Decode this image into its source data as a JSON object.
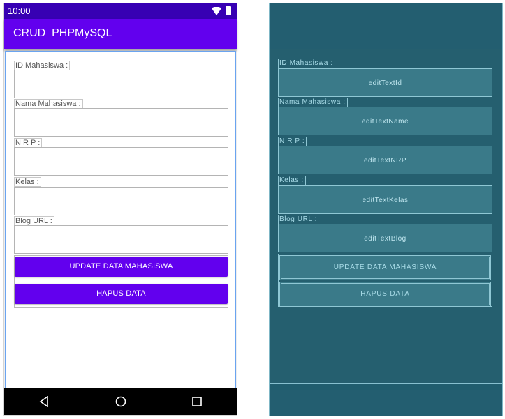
{
  "status_bar": {
    "time": "10:00"
  },
  "app_bar": {
    "title": "CRUD_PHPMySQL"
  },
  "form": {
    "fields": [
      {
        "label": "ID Mahasiswa :",
        "id": "editTextId"
      },
      {
        "label": "Nama Mahasiswa :",
        "id": "editTextName"
      },
      {
        "label": "N R P :",
        "id": "editTextNRP"
      },
      {
        "label": "Kelas :",
        "id": "editTextKelas"
      },
      {
        "label": "Blog URL :",
        "id": "editTextBlog"
      }
    ],
    "update_button": "UPDATE DATA MAHASISWA",
    "delete_button": "HAPUS DATA"
  },
  "colors": {
    "primary": "#6200ee",
    "primary_dark": "#3700b3",
    "blueprint_background": "#205d6e"
  },
  "icons": [
    "wifi-icon",
    "battery-icon",
    "back-icon",
    "home-icon",
    "recents-icon"
  ]
}
